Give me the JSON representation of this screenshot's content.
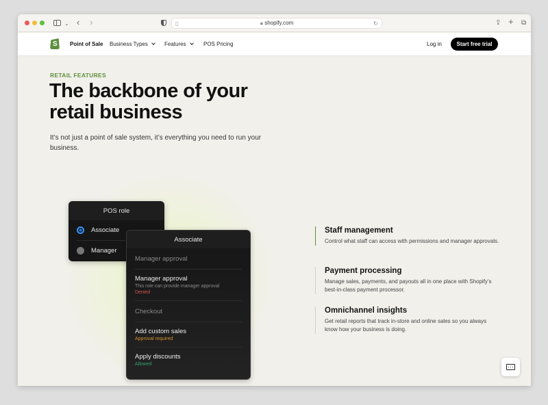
{
  "browser": {
    "url": "shopify.com",
    "icons": [
      "sidebar-icon",
      "chevron-down-icon",
      "back-icon",
      "forward-icon",
      "privacy-shield-icon",
      "page-icon",
      "lock-icon",
      "reload-icon",
      "share-icon",
      "new-tab-icon",
      "tabs-overview-icon"
    ]
  },
  "nav": {
    "brand": "Point of Sale",
    "logo_letter": "S",
    "items": [
      {
        "label": "Business Types",
        "dropdown": true
      },
      {
        "label": "Features",
        "dropdown": true
      },
      {
        "label": "POS Pricing",
        "dropdown": false
      }
    ],
    "login": "Log in",
    "cta": "Start free trial"
  },
  "hero": {
    "eyebrow": "RETAIL FEATURES",
    "title": "The backbone of your retail business",
    "subtitle": "It’s not just a point of sale system, it’s everything you need to run your business."
  },
  "role_card": {
    "title": "POS role",
    "options": [
      {
        "label": "Associate",
        "selected": true
      },
      {
        "label": "Manager",
        "selected": false
      }
    ]
  },
  "associate_card": {
    "title": "Associate",
    "sections": [
      {
        "heading": "Manager approval",
        "items": [
          {
            "title": "Manager approval",
            "description": "This role can provide manager approval",
            "status": "Denied",
            "status_color": "#d9534f"
          }
        ]
      },
      {
        "heading": "Checkout",
        "items": [
          {
            "title": "Add custom sales",
            "status": "Approval required",
            "status_color": "#d4922c"
          },
          {
            "title": "Apply discounts",
            "status": "Allowed",
            "status_color": "#2fa36b"
          }
        ]
      }
    ]
  },
  "features": [
    {
      "title": "Staff management",
      "description": "Control what staff can access with permissions and manager approvals.",
      "active": true
    },
    {
      "title": "Payment processing",
      "description": "Manage sales, payments, and payouts all in one place with Shopify’s best-in-class payment processor.",
      "active": false
    },
    {
      "title": "Omnichannel insights",
      "description": "Get retail reports that track in-store and online sales so you always know how your business is doing.",
      "active": false
    }
  ],
  "colors": {
    "brand_green": "#5e8e3e",
    "selected_radio": "#1d7be0",
    "denied": "#d9534f",
    "approval_required": "#d4922c",
    "allowed": "#2fa36b"
  }
}
